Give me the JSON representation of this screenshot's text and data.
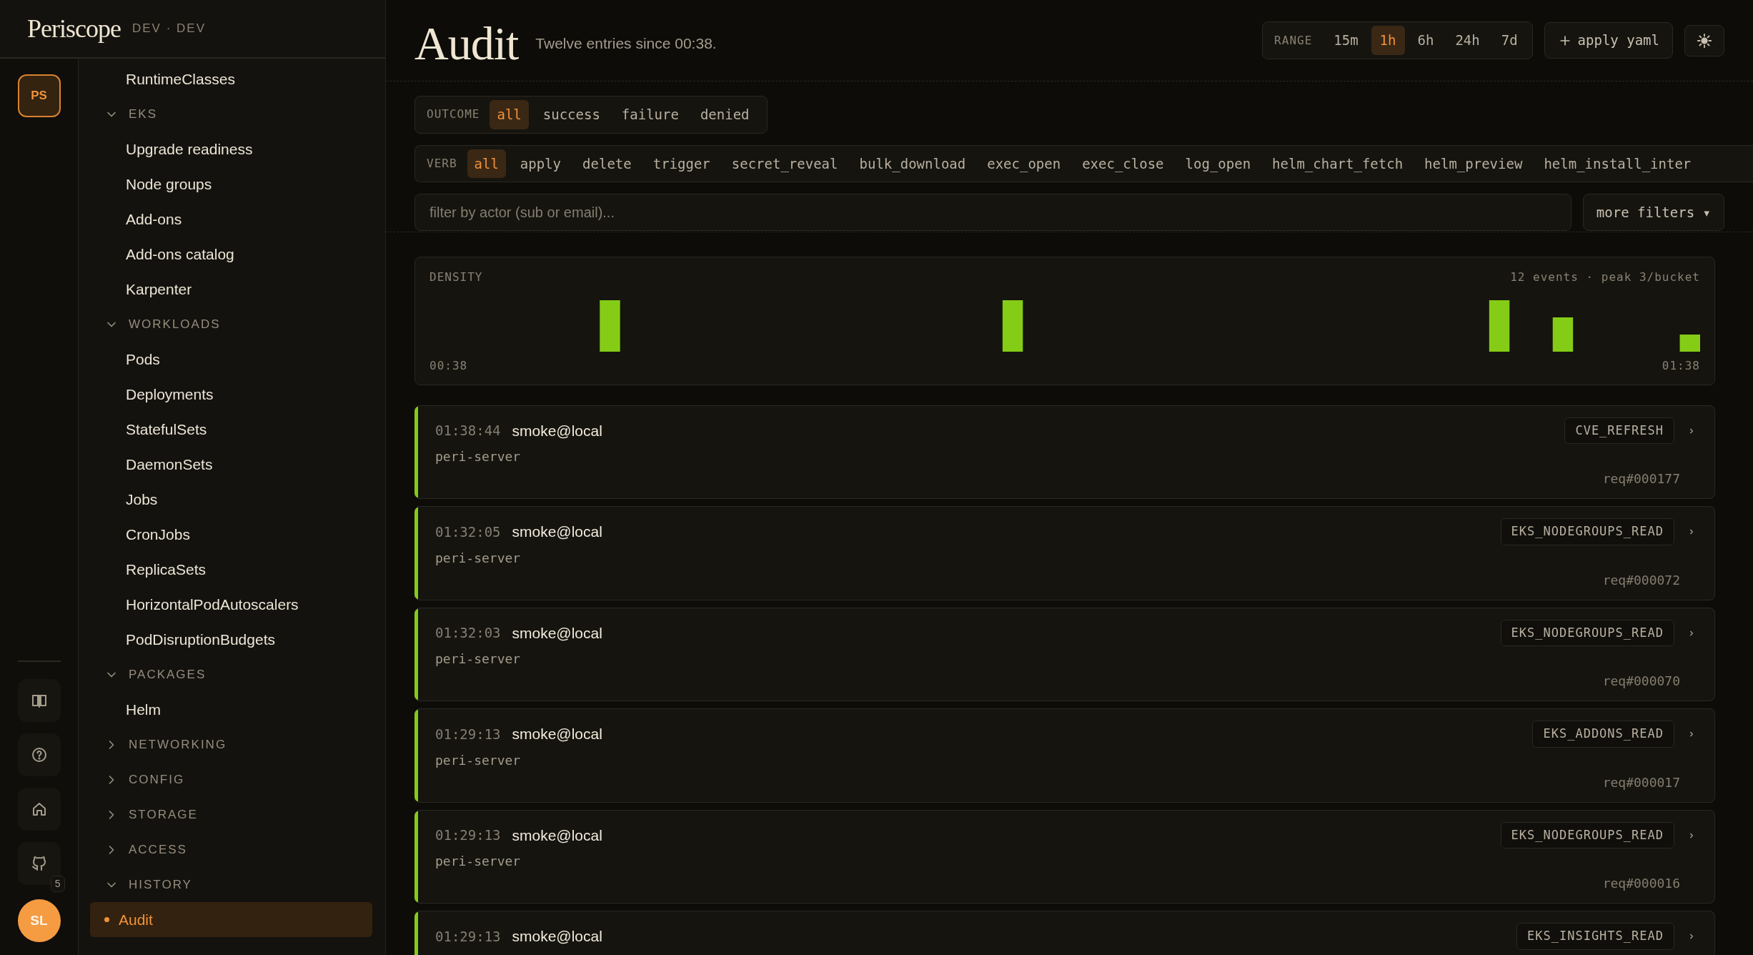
{
  "brand": {
    "name": "Periscope",
    "env": "DEV · DEV"
  },
  "rail": {
    "workspace": "PS",
    "badge": "5",
    "avatar": "SL"
  },
  "sidebar": {
    "items": [
      {
        "kind": "link",
        "label": "RuntimeClasses",
        "selected": false
      },
      {
        "kind": "group",
        "label": "EKS",
        "expanded": true,
        "children": [
          {
            "kind": "link",
            "label": "Upgrade readiness",
            "selected": false
          },
          {
            "kind": "link",
            "label": "Node groups",
            "selected": false
          },
          {
            "kind": "link",
            "label": "Add-ons",
            "selected": false
          },
          {
            "kind": "link",
            "label": "Add-ons catalog",
            "selected": false
          },
          {
            "kind": "link",
            "label": "Karpenter",
            "selected": false
          }
        ]
      },
      {
        "kind": "group",
        "label": "WORKLOADS",
        "expanded": true,
        "children": [
          {
            "kind": "link",
            "label": "Pods",
            "selected": false
          },
          {
            "kind": "link",
            "label": "Deployments",
            "selected": false
          },
          {
            "kind": "link",
            "label": "StatefulSets",
            "selected": false
          },
          {
            "kind": "link",
            "label": "DaemonSets",
            "selected": false
          },
          {
            "kind": "link",
            "label": "Jobs",
            "selected": false
          },
          {
            "kind": "link",
            "label": "CronJobs",
            "selected": false
          },
          {
            "kind": "link",
            "label": "ReplicaSets",
            "selected": false
          },
          {
            "kind": "link",
            "label": "HorizontalPodAutoscalers",
            "selected": false
          },
          {
            "kind": "link",
            "label": "PodDisruptionBudgets",
            "selected": false
          }
        ]
      },
      {
        "kind": "group",
        "label": "PACKAGES",
        "expanded": true,
        "children": [
          {
            "kind": "link",
            "label": "Helm",
            "selected": false
          }
        ]
      },
      {
        "kind": "group",
        "label": "NETWORKING",
        "expanded": false
      },
      {
        "kind": "group",
        "label": "CONFIG",
        "expanded": false
      },
      {
        "kind": "group",
        "label": "STORAGE",
        "expanded": false
      },
      {
        "kind": "group",
        "label": "ACCESS",
        "expanded": false
      },
      {
        "kind": "group",
        "label": "HISTORY",
        "expanded": true,
        "children": [
          {
            "kind": "link",
            "label": "Audit",
            "selected": true
          }
        ]
      }
    ]
  },
  "header": {
    "title": "Audit",
    "subtitle": "Twelve entries since 00:38.",
    "range": {
      "label": "RANGE",
      "options": [
        {
          "label": "15m",
          "selected": false
        },
        {
          "label": "1h",
          "selected": true
        },
        {
          "label": "6h",
          "selected": false
        },
        {
          "label": "24h",
          "selected": false
        },
        {
          "label": "7d",
          "selected": false
        }
      ]
    },
    "apply_button": "apply yaml"
  },
  "filters": {
    "outcome": {
      "label": "OUTCOME",
      "options": [
        {
          "label": "all",
          "selected": true
        },
        {
          "label": "success",
          "selected": false
        },
        {
          "label": "failure",
          "selected": false
        },
        {
          "label": "denied",
          "selected": false
        }
      ]
    },
    "verb": {
      "label": "VERB",
      "options": [
        {
          "label": "all",
          "selected": true
        },
        {
          "label": "apply",
          "selected": false
        },
        {
          "label": "delete",
          "selected": false
        },
        {
          "label": "trigger",
          "selected": false
        },
        {
          "label": "secret_reveal",
          "selected": false
        },
        {
          "label": "bulk_download",
          "selected": false
        },
        {
          "label": "exec_open",
          "selected": false
        },
        {
          "label": "exec_close",
          "selected": false
        },
        {
          "label": "log_open",
          "selected": false
        },
        {
          "label": "helm_chart_fetch",
          "selected": false
        },
        {
          "label": "helm_preview",
          "selected": false
        },
        {
          "label": "helm_install_inter",
          "selected": false
        }
      ]
    },
    "actor": {
      "placeholder": "filter by actor (sub or email)..."
    },
    "more_button": "more filters ▾"
  },
  "density": {
    "title": "DENSITY",
    "summary": "12 events · peak 3/bucket",
    "start": "00:38",
    "end": "01:38"
  },
  "entries": [
    {
      "time": "01:38:44",
      "actor": "smoke@local",
      "source": "peri-server",
      "action": "CVE_REFRESH",
      "request": "req#000177",
      "color": "#84cc16"
    },
    {
      "time": "01:32:05",
      "actor": "smoke@local",
      "source": "peri-server",
      "action": "EKS_NODEGROUPS_READ",
      "request": "req#000072",
      "color": "#84cc16"
    },
    {
      "time": "01:32:03",
      "actor": "smoke@local",
      "source": "peri-server",
      "action": "EKS_NODEGROUPS_READ",
      "request": "req#000070",
      "color": "#84cc16"
    },
    {
      "time": "01:29:13",
      "actor": "smoke@local",
      "source": "peri-server",
      "action": "EKS_ADDONS_READ",
      "request": "req#000017",
      "color": "#84cc16"
    },
    {
      "time": "01:29:13",
      "actor": "smoke@local",
      "source": "peri-server",
      "action": "EKS_NODEGROUPS_READ",
      "request": "req#000016",
      "color": "#84cc16"
    },
    {
      "time": "01:29:13",
      "actor": "smoke@local",
      "action": "EKS_INSIGHTS_READ",
      "color": "#84cc16"
    }
  ]
}
